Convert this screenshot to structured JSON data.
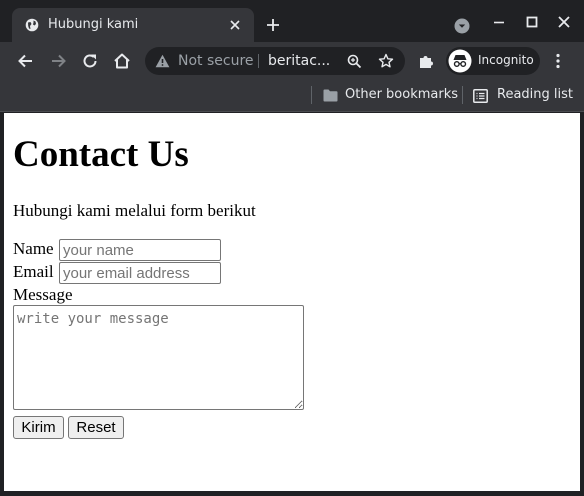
{
  "browser": {
    "tab": {
      "title": "Hubungi kami",
      "favicon": "globe-icon",
      "close_icon": "close-icon"
    },
    "new_tab_icon": "plus-icon",
    "tab_search_icon": "chevron-down-icon",
    "window_controls": [
      "minimize-icon",
      "maximize-icon",
      "close-icon"
    ],
    "toolbar": {
      "back_icon": "arrow-left-icon",
      "forward_icon": "arrow-right-icon",
      "reload_icon": "reload-icon",
      "home_icon": "home-icon",
      "security_label": "Not secure",
      "url": "beritac...",
      "zoom_icon": "zoom-icon",
      "bookmark_star_icon": "star-icon",
      "extensions_icon": "puzzle-icon",
      "profile_label": "Incognito",
      "menu_icon": "kebab-menu-icon"
    },
    "bookmarks_bar": {
      "other_bookmarks": "Other bookmarks",
      "reading_list": "Reading list"
    }
  },
  "page": {
    "title": "Contact Us",
    "description": "Hubungi kami melalui form berikut",
    "form": {
      "name_label": "Name",
      "name_placeholder": "your name",
      "email_label": "Email",
      "email_placeholder": "your email address",
      "message_label": "Message",
      "message_placeholder": "write your message",
      "submit_label": "Kirim",
      "reset_label": "Reset"
    }
  },
  "colors": {
    "titlebar": "#202124",
    "toolbar": "#35363a",
    "page_background": "#ffffff"
  }
}
